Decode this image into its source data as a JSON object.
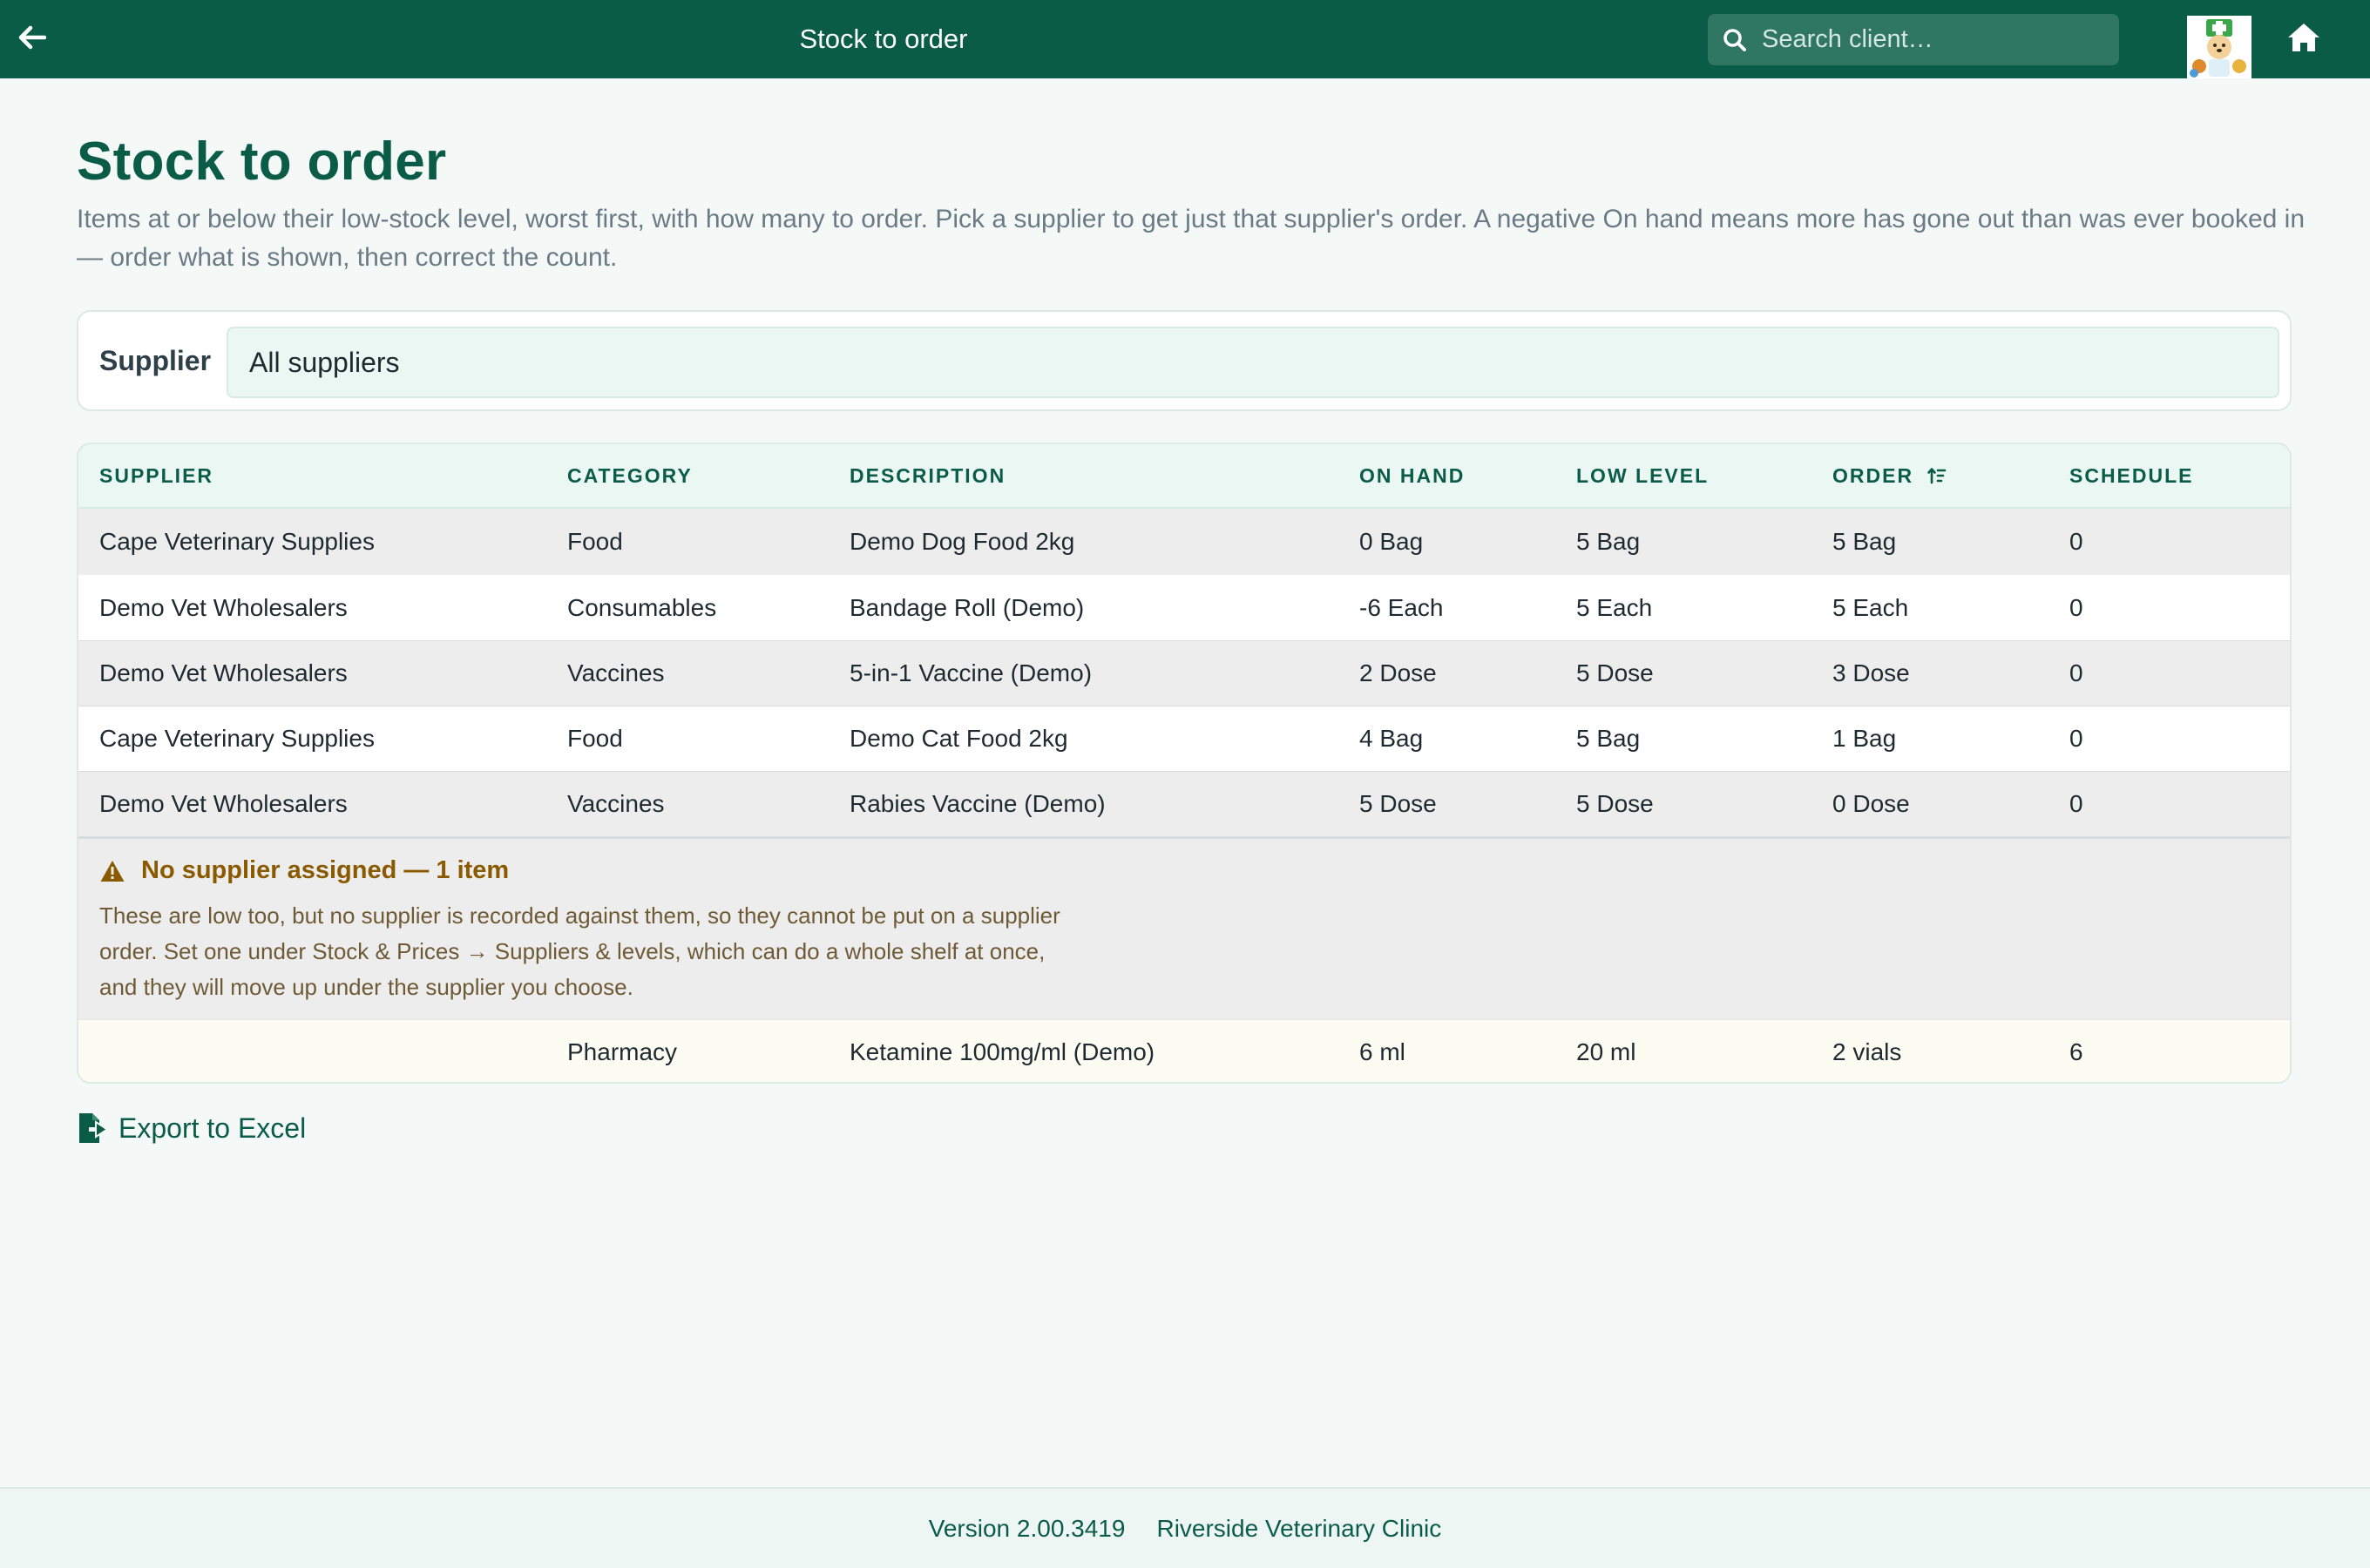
{
  "topbar": {
    "title": "Stock to order",
    "search_placeholder": "Search client…",
    "icons": [
      "arrow-left-icon",
      "search-icon",
      "clinic-logo",
      "home-icon"
    ]
  },
  "page": {
    "title": "Stock to order",
    "description": "Items at or below their low-stock level, worst first, with how many to order. Pick a supplier to get just that supplier's order. A negative On hand means more has gone out than was ever booked in — order what is shown, then correct the count."
  },
  "filter": {
    "label": "Supplier",
    "selected": "All suppliers"
  },
  "table": {
    "columns": [
      "SUPPLIER",
      "CATEGORY",
      "DESCRIPTION",
      "ON HAND",
      "LOW LEVEL",
      "ORDER",
      "SCHEDULE"
    ],
    "sorted_column": "ORDER",
    "rows": [
      [
        "Cape Veterinary Supplies",
        "Food",
        "Demo Dog Food 2kg",
        "0 Bag",
        "5 Bag",
        "5 Bag",
        "0"
      ],
      [
        "Demo Vet Wholesalers",
        "Consumables",
        "Bandage Roll (Demo)",
        "-6 Each",
        "5 Each",
        "5 Each",
        "0"
      ],
      [
        "Demo Vet Wholesalers",
        "Vaccines",
        "5-in-1 Vaccine (Demo)",
        "2 Dose",
        "5 Dose",
        "3 Dose",
        "0"
      ],
      [
        "Cape Veterinary Supplies",
        "Food",
        "Demo Cat Food 2kg",
        "4 Bag",
        "5 Bag",
        "1 Bag",
        "0"
      ],
      [
        "Demo Vet Wholesalers",
        "Vaccines",
        "Rabies Vaccine (Demo)",
        "5 Dose",
        "5 Dose",
        "0 Dose",
        "0"
      ]
    ]
  },
  "unassigned": {
    "title": "No supplier assigned — 1 item",
    "text": "These are low too, but no supplier is recorded against them, so they cannot be put on a supplier order. Set one under Stock & Prices → Suppliers & levels, which can do a whole shelf at once, and they will move up under the supplier you choose.",
    "rows": [
      [
        "",
        "Pharmacy",
        "Ketamine 100mg/ml (Demo)",
        "6 ml",
        "20 ml",
        "2 vials",
        "6"
      ]
    ]
  },
  "export_label": "Export to Excel",
  "footer": {
    "version": "Version 2.00.3419",
    "clinic": "Riverside Veterinary Clinic"
  },
  "colors": {
    "brand": "#0b5c47",
    "background": "#f4f9f8",
    "warning": "#8a5a00"
  }
}
